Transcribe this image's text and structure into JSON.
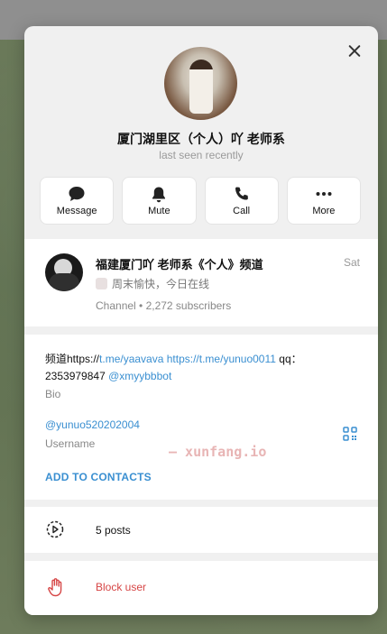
{
  "profile": {
    "name": "厦门湖里区（个人）吖 老师系",
    "status": "last seen recently"
  },
  "actions": [
    {
      "label": "Message",
      "icon": "message-icon"
    },
    {
      "label": "Mute",
      "icon": "bell-icon"
    },
    {
      "label": "Call",
      "icon": "phone-icon"
    },
    {
      "label": "More",
      "icon": "more-dots-icon"
    }
  ],
  "channel": {
    "title": "福建厦门吖 老师系《个人》频道",
    "date": "Sat",
    "message": "周末愉快，今日在线",
    "subtitle": "Channel • 2,272 subscribers"
  },
  "bio": {
    "prefix": "频道https://",
    "link1": "t.me/yaavava",
    "link2": "https://t.me/yunuo0011",
    "qq": " qq：2353979847 ",
    "link3": "@xmyybbbot",
    "label": "Bio"
  },
  "username": {
    "value": "@yunuo520202004",
    "label": "Username"
  },
  "add_contacts": "ADD TO CONTACTS",
  "posts": "5 posts",
  "block": "Block user",
  "watermark": "— xunfang.io",
  "colors": {
    "accent": "#3a8fd1",
    "danger": "#d64545"
  }
}
